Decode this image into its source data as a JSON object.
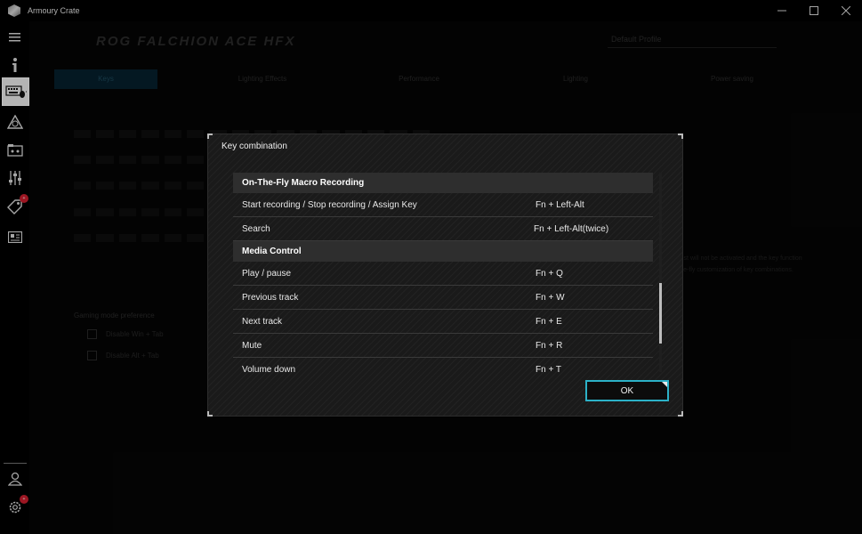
{
  "window": {
    "title": "Armoury Crate",
    "minimize": "—",
    "maximize": "☐",
    "close": "✕"
  },
  "sidebar": {
    "items": [
      {
        "icon": "hamburger-menu-icon"
      },
      {
        "icon": "info-icon"
      },
      {
        "icon": "keyboard-icon",
        "active": true
      },
      {
        "icon": "aura-sync-icon"
      },
      {
        "icon": "gamevisual-icon"
      },
      {
        "icon": "equalizer-icon"
      },
      {
        "icon": "deals-tag-icon",
        "badge": "+"
      },
      {
        "icon": "news-icon"
      },
      {
        "icon": "user-icon"
      },
      {
        "icon": "settings-icon",
        "badge": "+"
      }
    ]
  },
  "background": {
    "device_name": "ROG FALCHION ACE HFX",
    "profile": "Default Profile",
    "tabs": [
      "Keys",
      "Lighting Effects",
      "Performance",
      "Lighting",
      "Power saving"
    ],
    "section": "Gaming mode preference",
    "options": [
      "Disable Win + Tab",
      "Disable Alt + Tab"
    ],
    "right_text": "When turned on the Key list will not be activated and the key function will not trigger in the on-the-fly customization of key combinations."
  },
  "dialog": {
    "title": "Key combination",
    "rows": [
      {
        "type": "category",
        "name": "On-The-Fly Macro Recording"
      },
      {
        "type": "item",
        "name": "Start recording / Stop recording / Assign Key",
        "keys": "Fn + Left-Alt"
      },
      {
        "type": "item",
        "name": "Search",
        "keys": "Fn + Left-Alt(twice)"
      },
      {
        "type": "category",
        "name": "Media Control"
      },
      {
        "type": "item",
        "name": "Play / pause",
        "keys": "Fn + Q"
      },
      {
        "type": "item",
        "name": "Previous track",
        "keys": "Fn + W"
      },
      {
        "type": "item",
        "name": "Next track",
        "keys": "Fn + E"
      },
      {
        "type": "item",
        "name": "Mute",
        "keys": "Fn + R"
      },
      {
        "type": "item",
        "name": "Volume down",
        "keys": "Fn + T"
      }
    ],
    "ok_label": "OK"
  },
  "colors": {
    "accent": "#2cb1c7",
    "badge": "#d01e2e",
    "category_bg": "#2e2e2e"
  }
}
